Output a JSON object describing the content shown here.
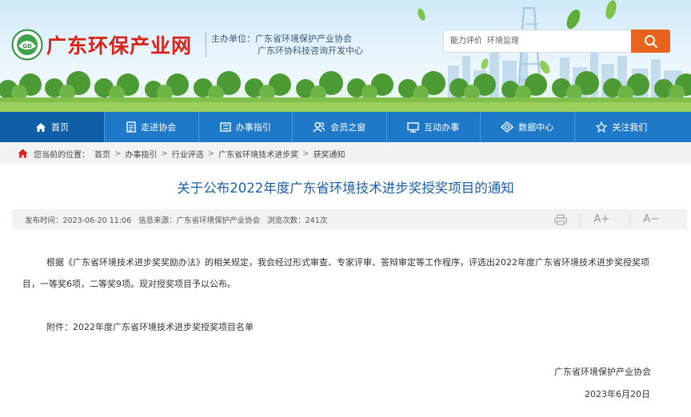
{
  "header": {
    "site_name": "广东环保产业网",
    "sponsor_line1": "主办单位：广东省环境保护产业协会",
    "sponsor_line2": "广东环协科技咨询开发中心",
    "search": {
      "hot_label": "能力评价",
      "hot_keyword": "环境监理"
    }
  },
  "nav": {
    "items": [
      {
        "label": "首页",
        "icon": "home-icon"
      },
      {
        "label": "走进协会",
        "icon": "document-icon"
      },
      {
        "label": "办事指引",
        "icon": "list-icon"
      },
      {
        "label": "会员之窗",
        "icon": "members-icon"
      },
      {
        "label": "互动办事",
        "icon": "monitor-icon"
      },
      {
        "label": "数据中心",
        "icon": "diamond-icon"
      },
      {
        "label": "关注我们",
        "icon": "star-icon"
      }
    ]
  },
  "breadcrumb": {
    "prefix": "您当前的位置：",
    "items": [
      "首页",
      "办事指引",
      "行业评选",
      "广东省环境技术进步奖",
      "获奖通知"
    ],
    "separator": ">"
  },
  "article": {
    "title": "关于公布2022年度广东省环境技术进步奖授奖项目的通知",
    "publish_time": "发布时间：2023-06-20 11:06",
    "source": "信息来源：广东省环境保护产业协会",
    "views": "浏览次数：241次",
    "font_increase": "A+",
    "font_decrease": "A−",
    "paragraph": "根据《广东省环境技术进步奖奖励办法》的相关规定，我会经过形式审查、专家评审、答辩审定等工作程序，评选出2022年度广东省环境技术进步奖授奖项目，一等奖6项，二等奖9项。现对授奖项目予以公布。",
    "attachment": "附件：2022年度广东省环境技术进步奖授奖项目名单",
    "signature_org": "广东省环境保护产业协会",
    "signature_date": "2023年6月20日"
  },
  "colors": {
    "brand_red": "#d8231c",
    "nav_blue": "#1f79c9",
    "nav_active": "#0f5fa8",
    "title_blue": "#1a5fa8",
    "search_orange": "#e8631e"
  }
}
